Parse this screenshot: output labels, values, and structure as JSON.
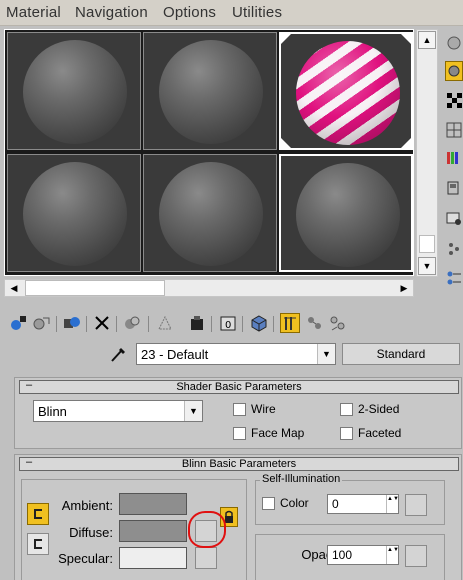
{
  "menu": [
    "Material",
    "Navigation",
    "Options",
    "Utilities"
  ],
  "material_name": "23 - Default",
  "material_type": "Standard",
  "shader_rollout": {
    "title": "Shader Basic Parameters",
    "collapse_symbol": "–",
    "shader": "Blinn",
    "options": [
      {
        "label": "Wire",
        "checked": false
      },
      {
        "label": "2-Sided",
        "checked": false
      },
      {
        "label": "Face Map",
        "checked": false
      },
      {
        "label": "Faceted",
        "checked": false
      }
    ]
  },
  "blinn_rollout": {
    "title": "Blinn Basic Parameters",
    "collapse_symbol": "–",
    "ambient_label": "Ambient:",
    "diffuse_label": "Diffuse:",
    "specular_label": "Specular:",
    "self_illum": {
      "title": "Self-Illumination",
      "color_label": "Color",
      "value": "0"
    },
    "opacity_label": "Opacity:",
    "opacity_value": "100"
  },
  "colors": {
    "accent_stripe": "#e0117f",
    "lock_active": "#f0c020",
    "annotation": "#e01010"
  },
  "icons": {
    "scroll_up": "▲",
    "scroll_down": "▼",
    "scroll_left": "◀",
    "scroll_right": "▶",
    "dropdown": "▼",
    "spin": "▲▼"
  }
}
